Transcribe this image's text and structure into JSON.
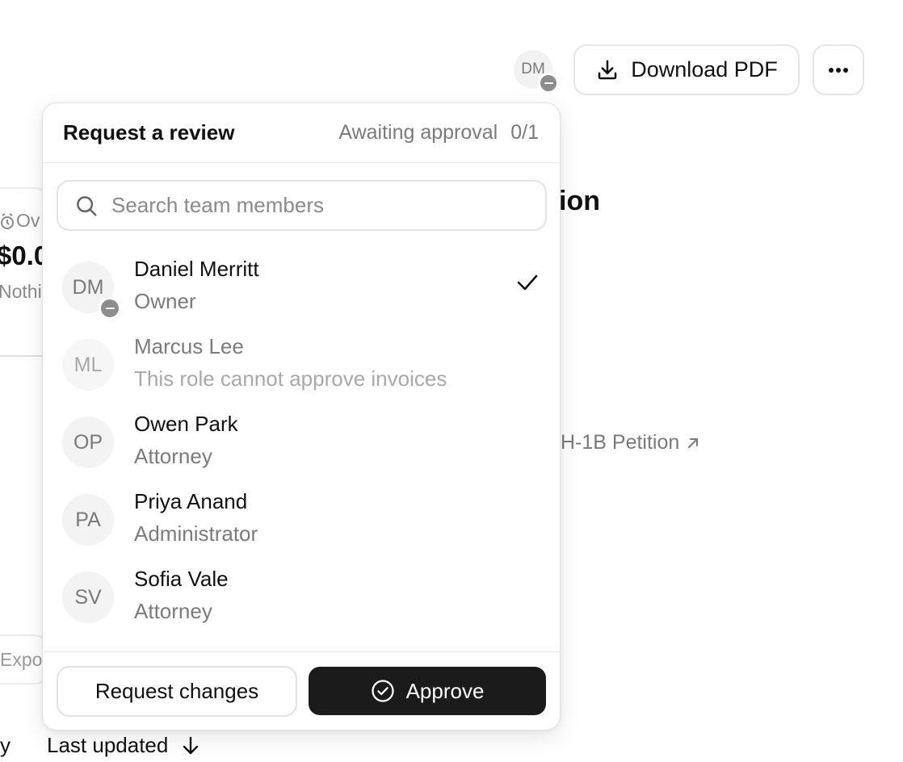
{
  "header": {
    "avatar_initials": "DM",
    "download_label": "Download PDF",
    "more_label": "More options"
  },
  "background": {
    "heading_fragment": "ion",
    "link_fragment": "H-1B Petition",
    "overdue_fragment": "Ov",
    "amount_fragment": "$0.0",
    "nothing_fragment": "Nothi",
    "export_fragment": "Expo",
    "sort_prefix_fragment": "y",
    "sort_label": "Last updated"
  },
  "popover": {
    "title": "Request a review",
    "status_label": "Awaiting approval",
    "status_count": "0/1",
    "search_placeholder": "Search team members",
    "members": [
      {
        "initials": "DM",
        "name": "Daniel Merritt",
        "role": "Owner",
        "selected": true,
        "disabled": false,
        "presence": "busy"
      },
      {
        "initials": "ML",
        "name": "Marcus Lee",
        "role": "This role cannot approve invoices",
        "selected": false,
        "disabled": true
      },
      {
        "initials": "OP",
        "name": "Owen Park",
        "role": "Attorney",
        "selected": false,
        "disabled": false
      },
      {
        "initials": "PA",
        "name": "Priya Anand",
        "role": "Administrator",
        "selected": false,
        "disabled": false
      },
      {
        "initials": "SV",
        "name": "Sofia Vale",
        "role": "Attorney",
        "selected": false,
        "disabled": false
      }
    ],
    "request_changes_label": "Request changes",
    "approve_label": "Approve"
  }
}
